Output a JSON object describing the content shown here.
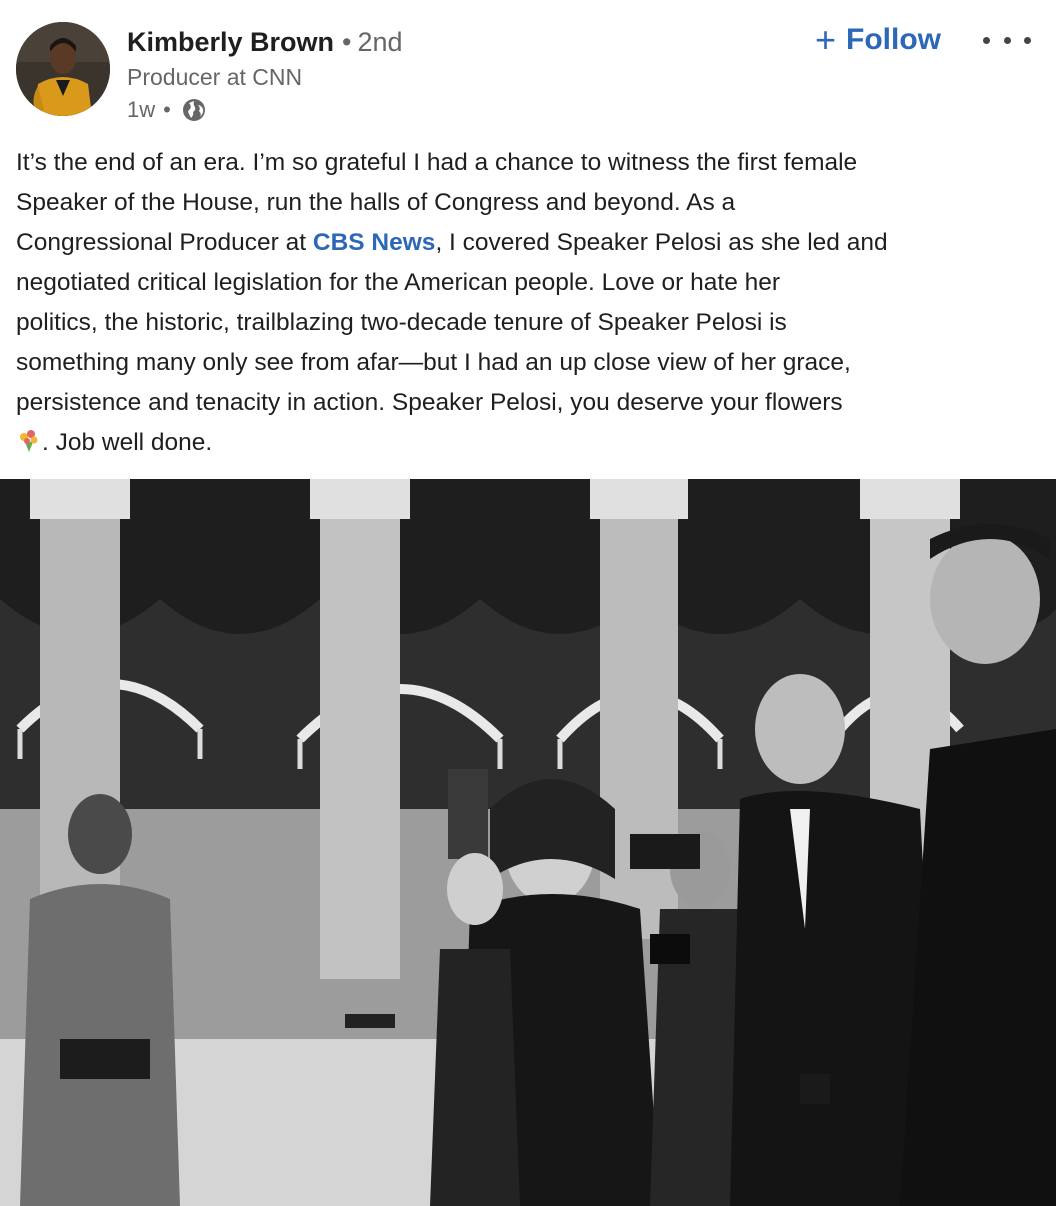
{
  "author": {
    "name": "Kimberly Brown",
    "degree": "2nd",
    "headline": "Producer at CNN",
    "posted": "1w",
    "visibility_icon": "globe-icon"
  },
  "actions": {
    "follow_label": "Follow",
    "follow_icon": "plus-icon",
    "more_icon": "ellipsis-icon"
  },
  "post": {
    "lines": [
      "It’s the end of an era. I’m so grateful I had a chance to witness the first female",
      "Speaker of the House, run the halls of Congress and beyond. As a",
      "",
      "negotiated critical legislation for the American people. Love or hate her",
      "politics, the historic, trailblazing two-decade tenure of Speaker Pelosi is",
      "something many only see from afar—but I had an up close view of her grace,",
      "persistence and tenacity in action. Speaker Pelosi, you deserve your flowers",
      ""
    ],
    "line3_before": "Congressional Producer at ",
    "mention": "CBS News",
    "line3_after": ", I covered Speaker Pelosi as she led and",
    "line8_icon": "bouquet-emoji-icon",
    "line8_text": ". Job well done."
  },
  "colors": {
    "link_blue": "#2d67b7",
    "text": "#1f1f1f",
    "muted": "#666666"
  }
}
